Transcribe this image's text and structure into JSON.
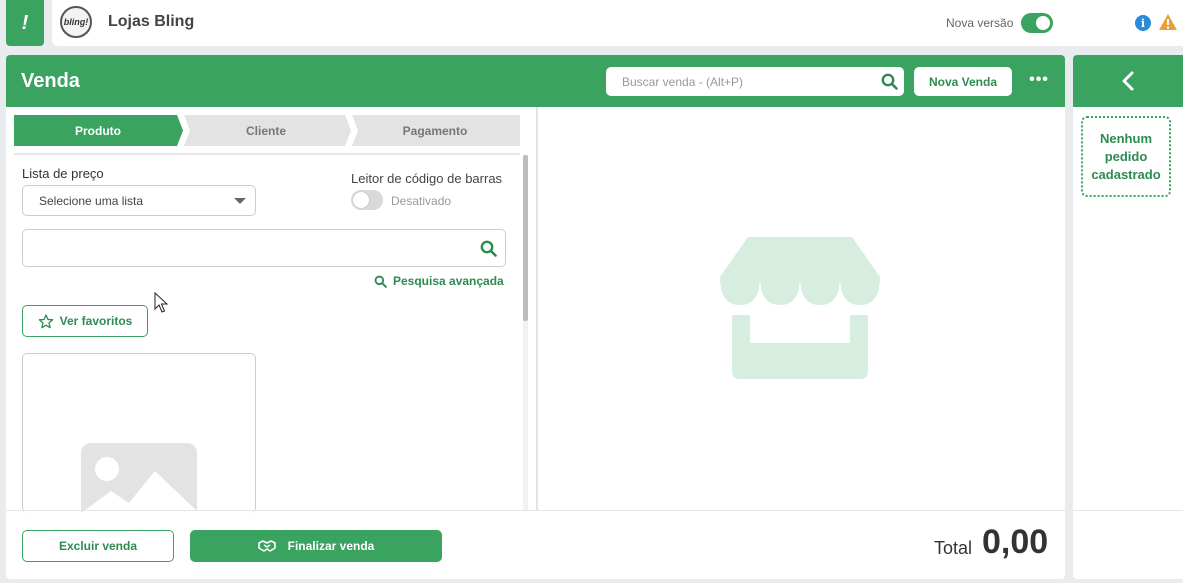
{
  "topbar": {
    "app_icon_glyph": "!",
    "company_logo_text": "bling!",
    "company_name": "Lojas Bling",
    "new_version_label": "Nova versão",
    "new_version_enabled": true
  },
  "header": {
    "title": "Venda",
    "search_placeholder": "Buscar venda - (Alt+P)",
    "new_sale_label": "Nova Venda",
    "more_label": "•••"
  },
  "stepper": {
    "steps": [
      {
        "label": "Produto",
        "active": true
      },
      {
        "label": "Cliente",
        "active": false
      },
      {
        "label": "Pagamento",
        "active": false
      }
    ]
  },
  "form": {
    "price_list_label": "Lista de preço",
    "price_list_value": "Selecione uma lista",
    "barcode_label": "Leitor de código de barras",
    "barcode_status": "Desativado",
    "barcode_enabled": false,
    "product_search_value": "",
    "advanced_search_label": "Pesquisa avançada",
    "favorites_label": "Ver favoritos"
  },
  "footer": {
    "delete_label": "Excluir venda",
    "finish_label": "Finalizar venda",
    "total_label": "Total",
    "total_value": "0,00"
  },
  "orders_panel": {
    "empty_text": "Nenhum pedido cadastrado"
  },
  "colors": {
    "brand_green": "#3aa35f",
    "text_green": "#2e8b50",
    "info_blue": "#2a8bd8",
    "warning_orange": "#e8a13a"
  },
  "icons": [
    "app-logo-icon",
    "info-icon",
    "warning-icon",
    "search-icon",
    "more-icon",
    "caret-down-icon",
    "star-icon",
    "image-placeholder-icon",
    "store-icon",
    "handshake-icon",
    "chevron-left-icon",
    "mouse-cursor-icon"
  ]
}
